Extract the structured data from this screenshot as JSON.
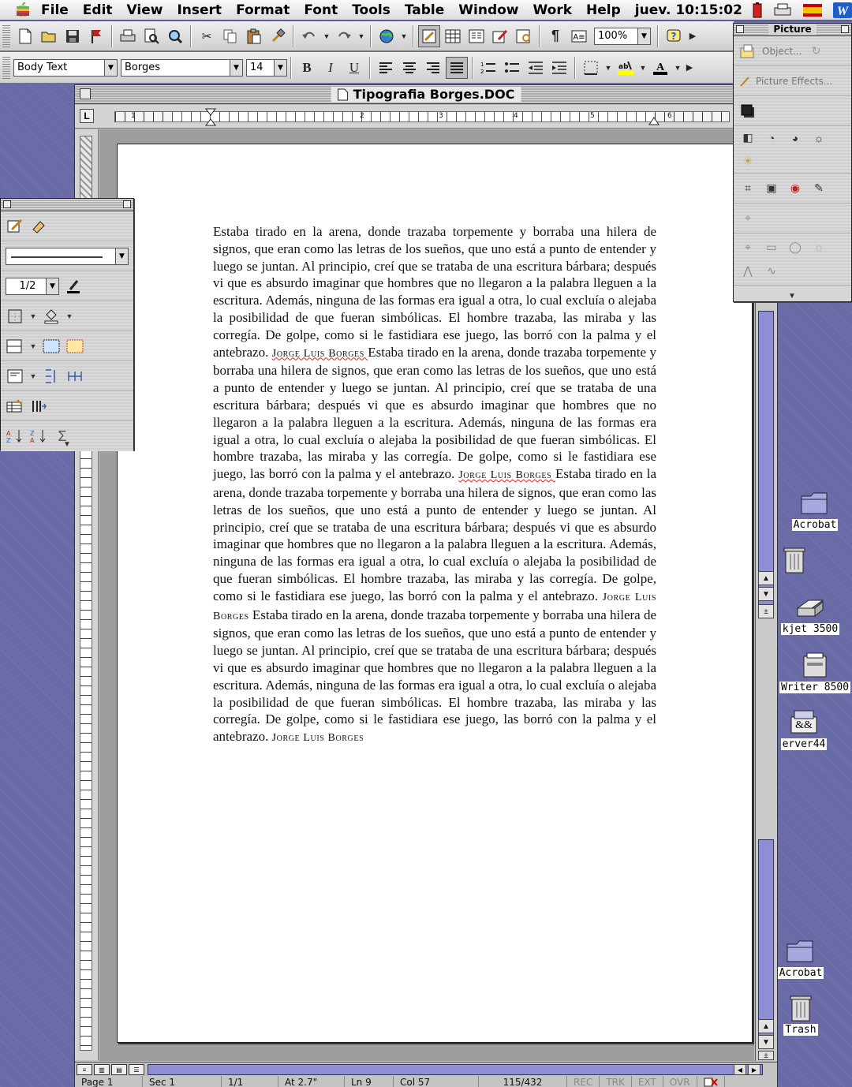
{
  "menubar": {
    "items": [
      "File",
      "Edit",
      "View",
      "Insert",
      "Format",
      "Font",
      "Tools",
      "Table",
      "Window",
      "Work",
      "Help"
    ],
    "clock": "juev. 10:15:02"
  },
  "toolbar_standard": {
    "zoom": "100%",
    "show_hide_symbol": "¶"
  },
  "toolbar_formatting": {
    "style": "Body Text",
    "font": "Borges",
    "size": "14",
    "bold": "B",
    "italic": "I",
    "underline": "U"
  },
  "document": {
    "title": "Tipografia Borges.DOC",
    "ruler_numbers": [
      "1",
      "2",
      "3",
      "4",
      "5",
      "6"
    ],
    "paragraphs": [
      {
        "text": "Estaba tirado en la arena, donde trazaba torpemente y borraba una hilera de signos, que eran como las letras de los sueños, que uno está a punto de entender y luego se juntan. Al principio, creí que se trataba de una escritura bárbara; después vi que es absurdo imaginar que hombres que no llegaron a la palabra lleguen a la escritura. Además, ninguna de las formas era igual a otra, lo cual excluía o alejaba la posibilidad de que fueran simbólicas. El hombre trazaba, las miraba y las corregía. De golpe, como si le fastidiara ese juego, las borró con la palma y el antebrazo.",
        "signature": "Jorge Luis Borges"
      },
      {
        "text": "Estaba tirado en la arena, donde trazaba torpemente y borraba una hilera de signos, que eran como las letras de los sueños, que uno está a punto de entender y luego se juntan. Al principio, creí que se trataba de una escritura bárbara; después vi que es absurdo imaginar que hombres que no llegaron a la palabra lleguen a la escritura. Además, ninguna de las formas era igual a otra, lo cual excluía o alejaba la posibilidad de que fueran simbólicas. El hombre trazaba, las miraba y las corregía. De golpe, como si le fastidiara ese juego, las borró con la palma y el antebrazo.",
        "signature": "Jorge Luis Borges"
      },
      {
        "text": "Estaba tirado en la arena, donde trazaba torpemente y borraba una hilera de signos, que eran como las letras de los sueños, que uno está a punto de entender y luego se juntan. Al principio, creí que se trataba de una escritura bárbara; después vi que es absurdo imaginar que hombres que no llegaron a la palabra lleguen a la escritura. Además, ninguna de las formas era igual a otra, lo cual excluía o alejaba la posibilidad de que fueran simbólicas. El hombre trazaba, las miraba y las corregía. De golpe, como si le fastidiara ese juego, las borró con la palma y el antebrazo.",
        "signature": "Jorge Luis Borges"
      },
      {
        "text": "Estaba tirado en la arena, donde trazaba torpemente y borraba una hilera de signos, que eran como las letras de los sueños, que uno está a punto de entender y luego se juntan. Al principio, creí que se trataba de una escritura bárbara; después vi que es absurdo imaginar que hombres que no llegaron a la palabra lleguen a la escritura. Además, ninguna de las formas era igual a otra, lo cual excluía o alejaba la posibilidad de que fueran simbólicas. El hombre trazaba, las miraba y las corregía. De golpe, como si le fastidiara ese juego, las borró con la palma y el antebrazo.",
        "signature": "Jorge Luis Borges"
      }
    ]
  },
  "status": {
    "page": "Page 1",
    "sec": "Sec 1",
    "pages": "1/1",
    "at": "At 2.7\"",
    "ln": "Ln 9",
    "col": "Col 57",
    "words": "115/432",
    "rec": "REC",
    "trk": "TRK",
    "ext": "EXT",
    "ovr": "OVR"
  },
  "tables_palette": {
    "line_weight": "1/2"
  },
  "picture_palette": {
    "title": "Picture",
    "object_label": "Object...",
    "effects_label": "Picture Effects..."
  },
  "desktop": {
    "icons": [
      "Acrobat",
      "kjet 3500",
      "Writer 8500",
      "erver44",
      "Acrobat",
      "Trash"
    ]
  },
  "colors": {
    "desktop": "#6a6aa6",
    "scroll_thumb": "#8e8ed4"
  }
}
